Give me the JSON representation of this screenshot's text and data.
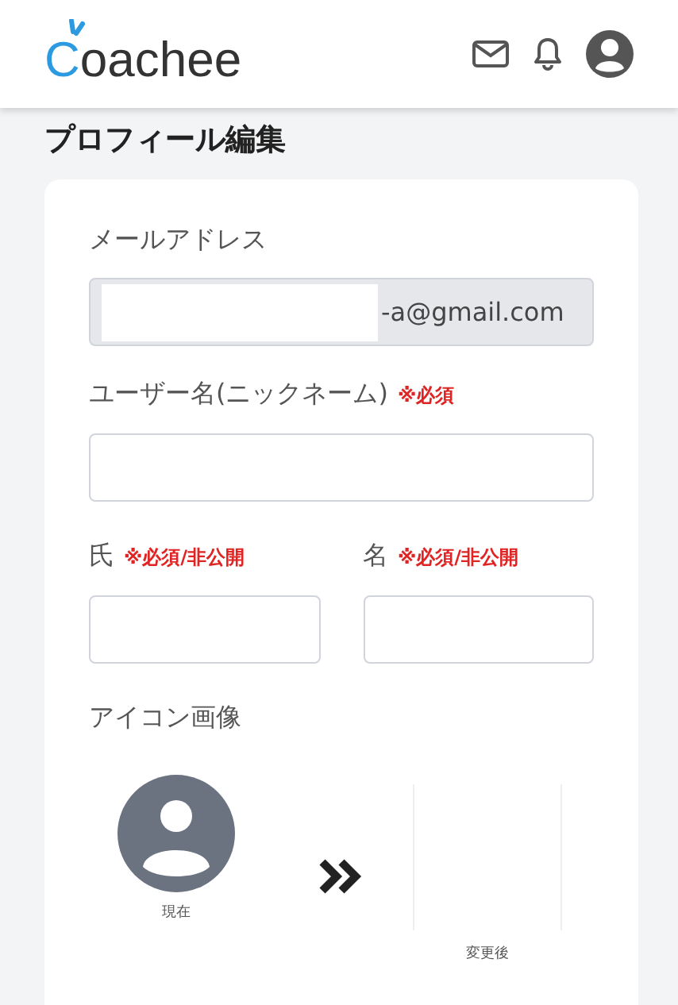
{
  "header": {
    "logo": "Coachee"
  },
  "page_title": "プロフィール編集",
  "form": {
    "email": {
      "label": "メールアドレス",
      "value": "-a@gmail.com",
      "disabled": true
    },
    "username": {
      "label": "ユーザー名(ニックネーム)",
      "required": "※必須"
    },
    "name_fields": [
      {
        "label": "氏",
        "required": "※必須/非公開"
      },
      {
        "label": "名",
        "required": "※必須/非公開"
      }
    ],
    "icon_image": {
      "label": "アイコン画像",
      "current_caption": "現在",
      "new_caption": "変更後"
    }
  }
}
